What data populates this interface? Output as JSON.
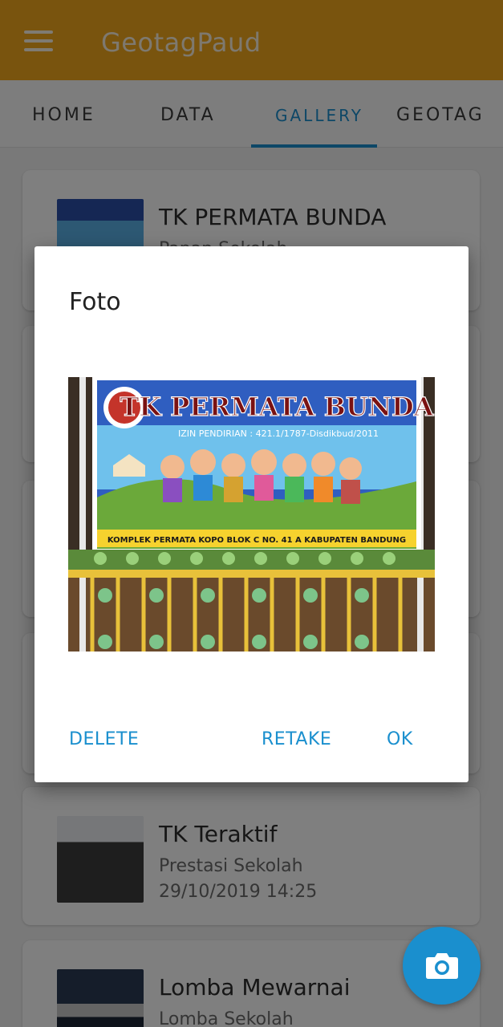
{
  "app_bar": {
    "title": "GeotagPaud"
  },
  "tabs": [
    {
      "label": "HOME"
    },
    {
      "label": "DATA"
    },
    {
      "label": "GALLERY"
    },
    {
      "label": "GEOTAG"
    }
  ],
  "gallery": {
    "items": [
      {
        "title": "TK PERMATA BUNDA",
        "subtitle": "Papan Sekolah",
        "date": ""
      },
      {
        "title": "TK Teraktif",
        "subtitle": "Prestasi Sekolah",
        "date": "29/10/2019 14:25"
      },
      {
        "title": "Lomba Mewarnai",
        "subtitle": "Lomba Sekolah",
        "date": ""
      }
    ]
  },
  "dialog": {
    "title": "Foto",
    "photo": {
      "sign_title": "TK PERMATA BUNDA",
      "sign_license": "IZIN PENDIRIAN : 421.1/1787-Disdikbud/2011",
      "sign_address": "KOMPLEK PERMATA KOPO BLOK C NO. 41 A KABUPATEN BANDUNG"
    },
    "buttons": {
      "delete": "DELETE",
      "retake": "RETAKE",
      "ok": "OK"
    }
  },
  "fab": {
    "icon": "camera-icon"
  },
  "colors": {
    "primary": "#f2a81d",
    "accent": "#1a8fce"
  }
}
